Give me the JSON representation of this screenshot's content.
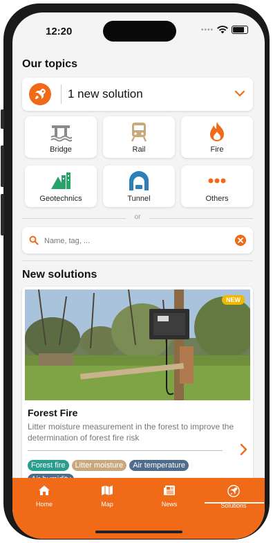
{
  "status": {
    "time": "12:20"
  },
  "topics": {
    "heading": "Our topics",
    "solutions_label": "1 new solution",
    "tiles": [
      {
        "label": "Bridge",
        "icon": "bridge-icon"
      },
      {
        "label": "Rail",
        "icon": "train-icon"
      },
      {
        "label": "Fire",
        "icon": "fire-icon"
      },
      {
        "label": "Geotechnics",
        "icon": "geotechnics-icon"
      },
      {
        "label": "Tunnel",
        "icon": "tunnel-icon"
      },
      {
        "label": "Others",
        "icon": "more-dots-icon"
      }
    ],
    "or_label": "or"
  },
  "search": {
    "placeholder": "Name, tag, ..."
  },
  "new_solutions": {
    "heading": "New solutions",
    "card": {
      "badge": "NEW",
      "title": "Forest Fire",
      "description": "Litter moisture measurement in the forest to improve the determination of forest fire risk",
      "tags": [
        {
          "label": "Forest fire",
          "color": "#2a9d8f"
        },
        {
          "label": "Litter moisture",
          "color": "#c8a97e"
        },
        {
          "label": "Air temperature",
          "color": "#4f6d8a"
        },
        {
          "label": "Air humidity",
          "color": "#4f6d8a"
        }
      ]
    }
  },
  "tabbar": {
    "items": [
      {
        "label": "Home",
        "icon": "home-icon"
      },
      {
        "label": "Map",
        "icon": "map-icon"
      },
      {
        "label": "News",
        "icon": "news-icon"
      },
      {
        "label": "Solutions",
        "icon": "rocket-icon"
      }
    ],
    "active": "Solutions"
  },
  "colors": {
    "accent": "#f06a17",
    "bridge": "#8a8a8a",
    "rail": "#c8a97e",
    "fire": "#f06a17",
    "geotechnics": "#2aa36b",
    "tunnel": "#2c7fb8",
    "others": "#f06a17"
  }
}
